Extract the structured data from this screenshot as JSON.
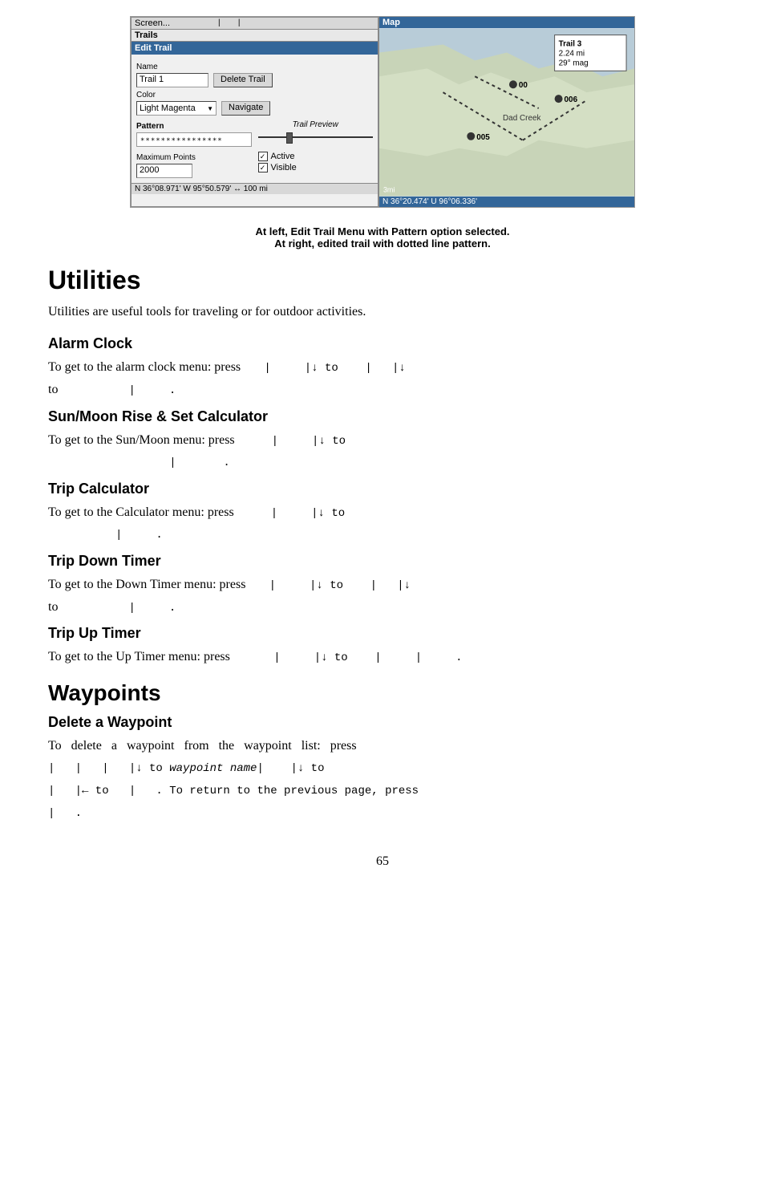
{
  "screenshot": {
    "left_panel": {
      "menu_bar": "Screen...",
      "trails_bar": "Trails",
      "edit_trail_bar": "Edit Trail",
      "name_label": "Name",
      "name_value": "Trail 1",
      "delete_btn": "Delete Trail",
      "color_label": "Color",
      "color_value": "Light Magenta",
      "navigate_btn": "Navigate",
      "pattern_label": "Pattern",
      "pattern_value": "****************",
      "trail_preview_label": "Trail Preview",
      "max_points_label": "Maximum Points",
      "max_points_value": "2000",
      "active_label": "Active",
      "visible_label": "Visible",
      "status_bar": "N  36°08.971'  W  95°50.579'    ↔    100 mi"
    },
    "right_panel": {
      "header": "Map",
      "trail3_label": "Trail 3",
      "trail3_dist": "2.24 mi",
      "trail3_mag": "29° mag",
      "dad_creek": "Dad Creek",
      "wp005": "005",
      "wp006": "006",
      "wp000": "00",
      "map_status": "N  36°20.474'  U  96°06.336'"
    }
  },
  "caption": {
    "line1": "At left, Edit Trail Menu with Pattern option selected.",
    "line2": "At right, edited trail with dotted line pattern."
  },
  "utilities": {
    "heading": "Utilities",
    "intro": "Utilities are useful tools for traveling or for outdoor activities."
  },
  "alarm_clock": {
    "heading": "Alarm Clock",
    "line1": "To get to the alarm clock menu: press",
    "line2": "to"
  },
  "sunmoon": {
    "heading": "Sun/Moon Rise & Set Calculator",
    "line1": "To get to the Sun/Moon menu: press"
  },
  "trip_calculator": {
    "heading": "Trip Calculator",
    "line1": "To get to the Calculator menu: press"
  },
  "trip_down_timer": {
    "heading": "Trip Down Timer",
    "line1": "To get to the Down Timer menu: press",
    "line2": "to"
  },
  "trip_up_timer": {
    "heading": "Trip Up Timer",
    "line1": "To get to the Up Timer menu: press"
  },
  "waypoints": {
    "heading": "Waypoints",
    "delete_heading": "Delete a Waypoint",
    "line1": "To   delete   a   waypoint   from   the   waypoint   list:   press",
    "line2": "to  waypoint name|",
    "line3": "|← to",
    "line4": ". To return to the previous page, press"
  },
  "page_number": "65"
}
